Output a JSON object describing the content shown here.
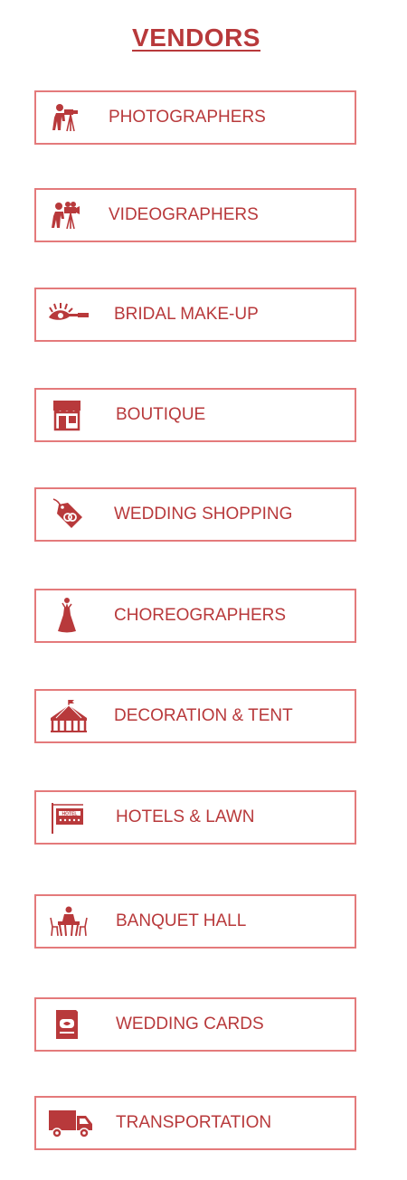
{
  "page": {
    "title": "VENDORS"
  },
  "theme": {
    "accent": "#b8393b",
    "border": "#e47a7b"
  },
  "vendors": [
    {
      "label": "PHOTOGRAPHERS",
      "icon": "camera-tripod-photographer-icon"
    },
    {
      "label": "VIDEOGRAPHERS",
      "icon": "video-camera-operator-icon"
    },
    {
      "label": "BRIDAL MAKE-UP",
      "icon": "eyelash-brush-icon"
    },
    {
      "label": "BOUTIQUE",
      "icon": "storefront-icon"
    },
    {
      "label": "WEDDING SHOPPING",
      "icon": "shopping-tag-rings-icon"
    },
    {
      "label": "CHOREOGRAPHERS",
      "icon": "dancer-icon"
    },
    {
      "label": "DECORATION & TENT",
      "icon": "tent-icon"
    },
    {
      "label": "HOTELS & LAWN",
      "icon": "hotel-sign-icon"
    },
    {
      "label": "BANQUET HALL",
      "icon": "banquet-table-icon"
    },
    {
      "label": "WEDDING CARDS",
      "icon": "wedding-card-icon"
    },
    {
      "label": "TRANSPORTATION",
      "icon": "delivery-truck-icon"
    }
  ]
}
